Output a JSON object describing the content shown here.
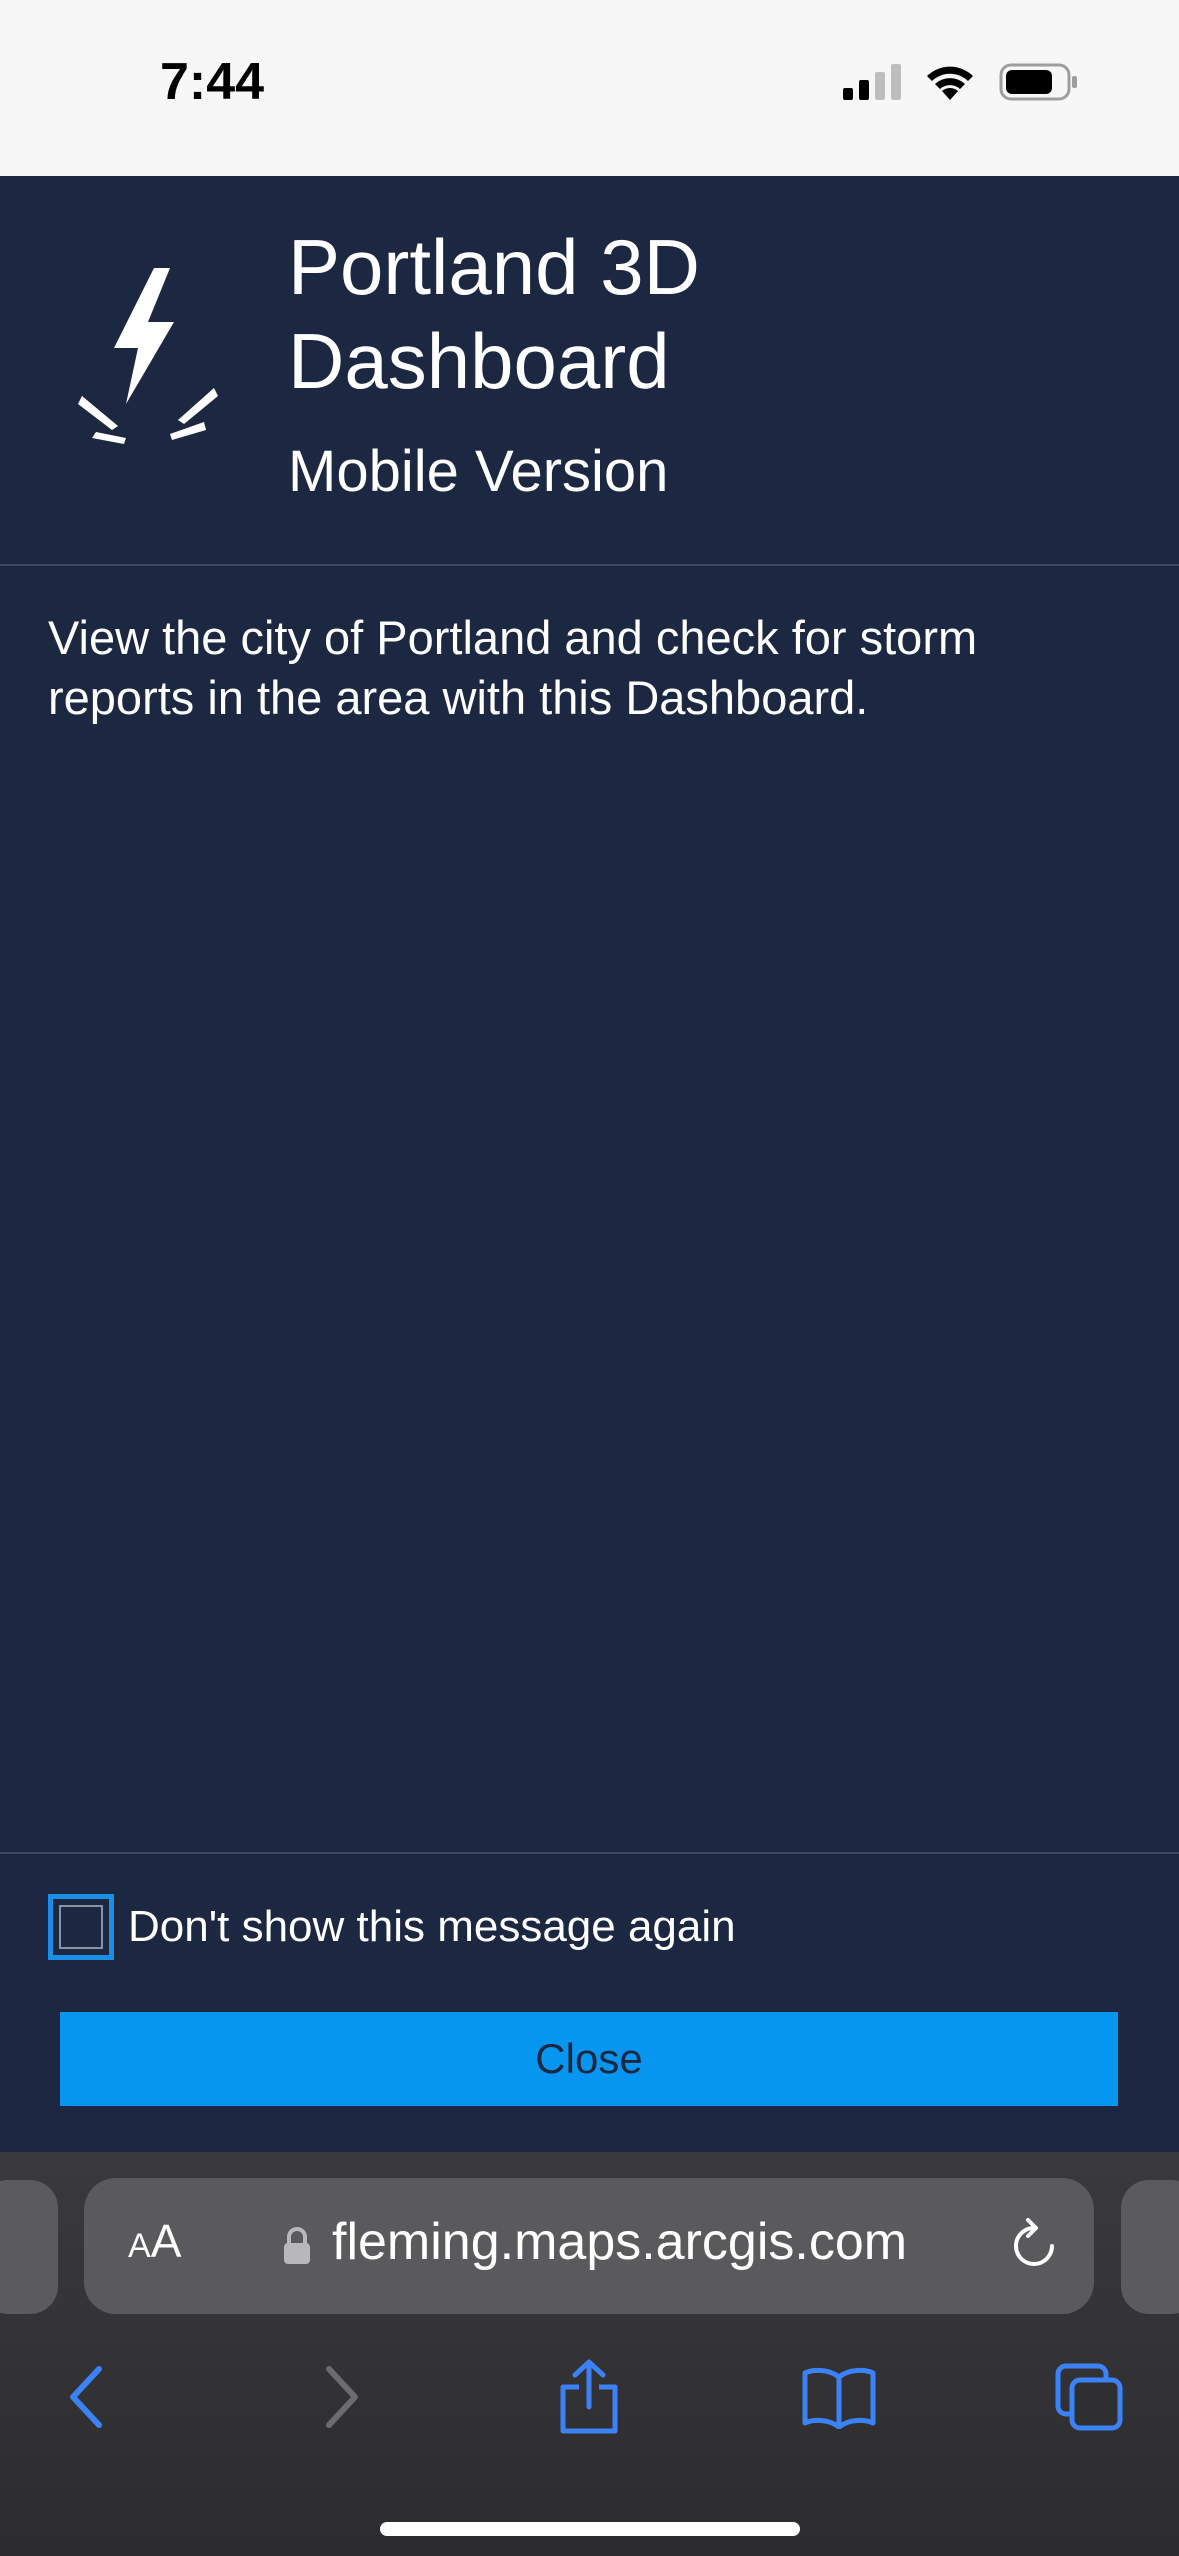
{
  "status_bar": {
    "time": "7:44",
    "icons": [
      "cellular-signal-icon",
      "wifi-icon",
      "battery-icon"
    ]
  },
  "dialog": {
    "title": "Portland 3D Dashboard",
    "subtitle": "Mobile Version",
    "logo_icon": "lightning-bolt-icon",
    "description": "View the city of Portland and check for storm reports in the area with this Dashboard.",
    "checkbox_label": "Don't show this message again",
    "checkbox_checked": false,
    "close_label": "Close"
  },
  "browser": {
    "text_size_label": "AA",
    "url": "fleming.maps.arcgis.com",
    "toolbar": [
      "back-icon",
      "forward-icon",
      "share-icon",
      "bookmarks-icon",
      "tabs-icon"
    ]
  },
  "colors": {
    "dialog_bg": "#1c2841",
    "accent": "#0696f0",
    "checkbox_border": "#1b8ee6",
    "ios_blue": "#3b82f6"
  }
}
